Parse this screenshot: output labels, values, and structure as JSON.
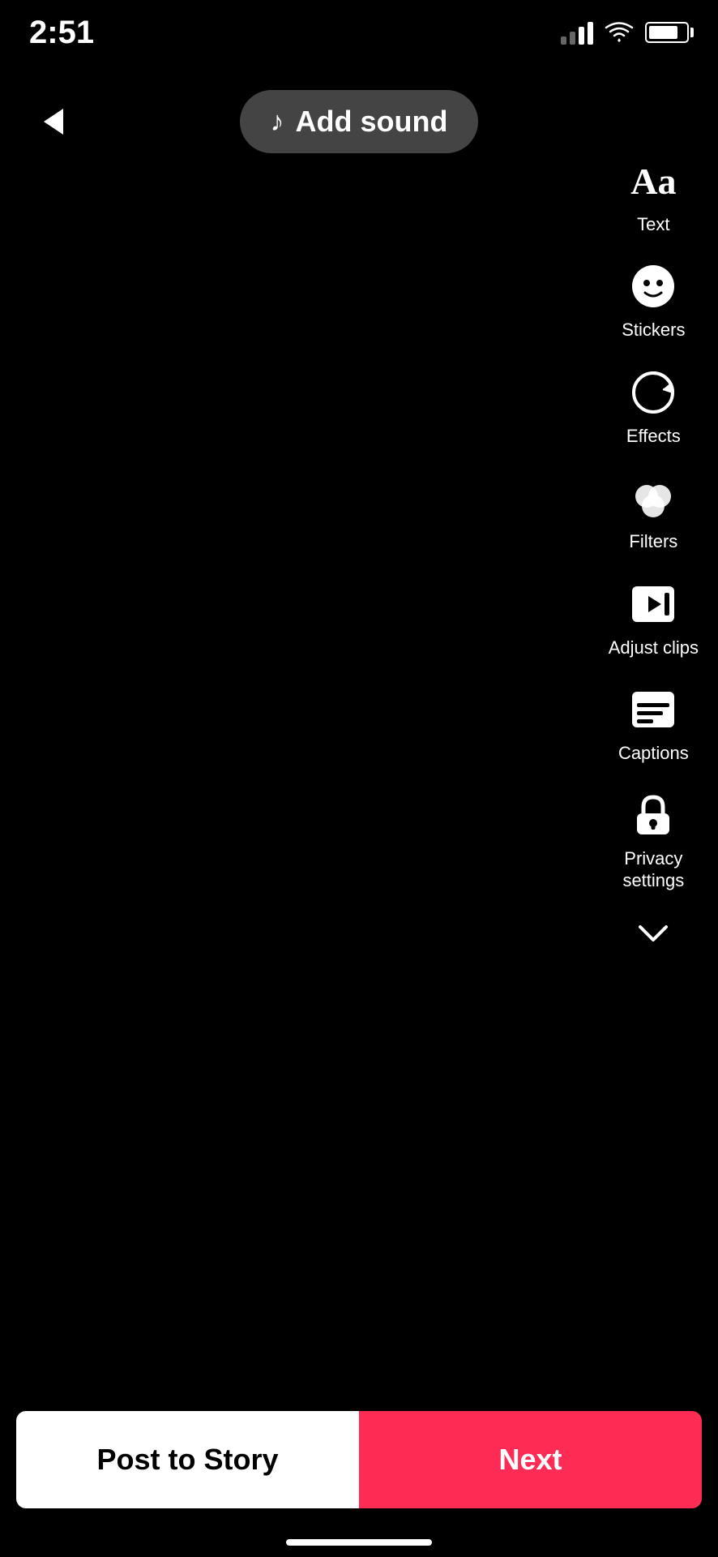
{
  "status": {
    "time": "2:51",
    "signal_bars": [
      3,
      5,
      8,
      11,
      14
    ],
    "battery_level": 80
  },
  "header": {
    "back_label": "back",
    "add_sound_label": "Add sound"
  },
  "sidebar": {
    "tools": [
      {
        "id": "text",
        "label": "Text",
        "icon": "text-icon"
      },
      {
        "id": "stickers",
        "label": "Stickers",
        "icon": "stickers-icon"
      },
      {
        "id": "effects",
        "label": "Effects",
        "icon": "effects-icon"
      },
      {
        "id": "filters",
        "label": "Filters",
        "icon": "filters-icon"
      },
      {
        "id": "adjust-clips",
        "label": "Adjust clips",
        "icon": "adjust-clips-icon"
      },
      {
        "id": "captions",
        "label": "Captions",
        "icon": "captions-icon"
      },
      {
        "id": "privacy-settings",
        "label": "Privacy\nsettings",
        "icon": "privacy-icon"
      }
    ],
    "chevron_down_label": "more options"
  },
  "bottom": {
    "post_to_story_label": "Post to Story",
    "next_label": "Next",
    "accent_color": "#fe2c55"
  }
}
